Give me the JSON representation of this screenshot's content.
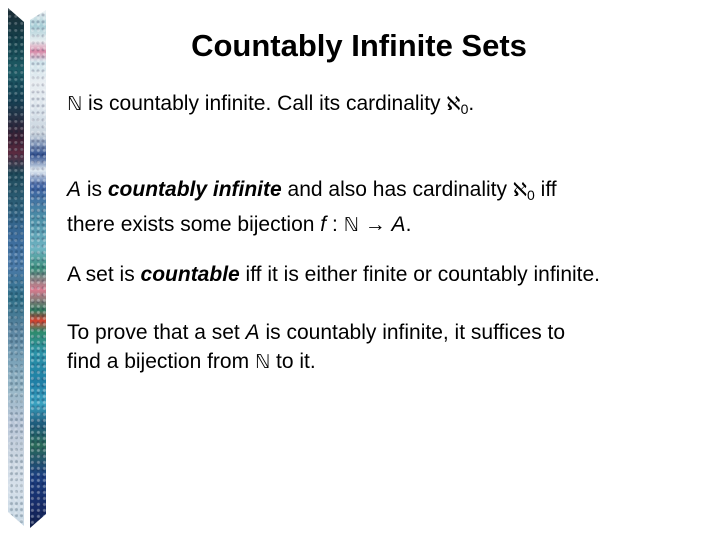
{
  "slide": {
    "title": "Countably Infinite Sets",
    "p1": {
      "naturals": "ℕ",
      "text_a": " is countably infinite.  Call its cardinality ",
      "aleph": "ℵ",
      "aleph_sub": "0",
      "text_b": "."
    },
    "p2": {
      "var_a": "A",
      "text_a": " is ",
      "emph": "countably infinite",
      "text_b": " and also has cardinality ",
      "aleph": "ℵ",
      "aleph_sub": "0",
      "text_c": " iff",
      "line2_text_a": "there exists some bijection ",
      "func": "f",
      "text_d": " : ",
      "naturals": "ℕ",
      "arrow": " → ",
      "var_b": "A",
      "text_e": "."
    },
    "p3": {
      "text_a": "A set is ",
      "emph": "countable",
      "text_b": " iff it is either finite or countably infinite."
    },
    "p4": {
      "text_a": "To prove that a set ",
      "var_a": "A",
      "text_b": " is countably infinite, it suffices to",
      "line2_text_a": "find a bijection from ",
      "naturals": "ℕ",
      "text_c": " to it."
    }
  }
}
